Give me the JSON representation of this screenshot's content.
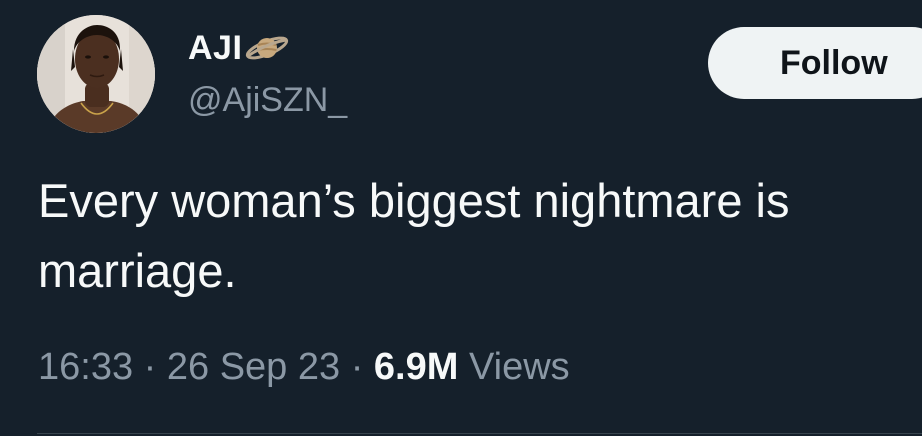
{
  "author": {
    "display_name": "AJI",
    "name_emoji": "saturn-icon",
    "handle": "@AjiSZN_",
    "avatar": "profile-photo"
  },
  "follow_label": "Follow",
  "tweet": {
    "text": "Every woman’s biggest nightmare is\nmarriage.",
    "time": "16:33",
    "date": "26 Sep 23",
    "separator": "·",
    "views_count": "6.9M",
    "views_label": "Views"
  },
  "colors": {
    "background": "#15202b",
    "text": "#f7f9f9",
    "secondary_text": "#8b98a5",
    "button_bg": "#eff3f4",
    "button_text": "#0f1419",
    "divider": "#38444d"
  }
}
